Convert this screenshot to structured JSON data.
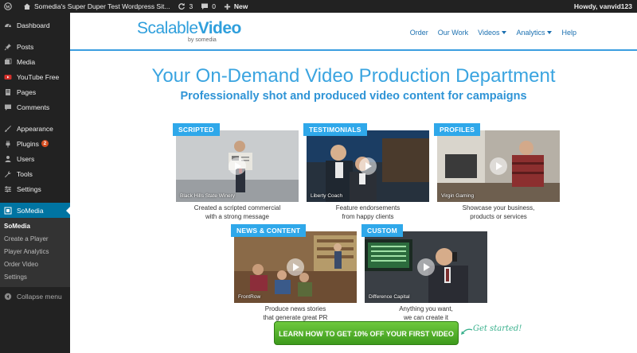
{
  "admin_bar": {
    "site_title": "Somedia's Super Duper Test Wordpress Sit...",
    "updates_count": "3",
    "comments_count": "0",
    "new_label": "New",
    "greeting": "Howdy, vanvid123"
  },
  "sidebar": {
    "items": [
      {
        "label": "Dashboard",
        "icon": "dashboard-icon"
      },
      {
        "label": "Posts",
        "icon": "pin-icon"
      },
      {
        "label": "Media",
        "icon": "media-icon"
      },
      {
        "label": "YouTube Free",
        "icon": "youtube-icon"
      },
      {
        "label": "Pages",
        "icon": "pages-icon"
      },
      {
        "label": "Comments",
        "icon": "comments-icon"
      },
      {
        "label": "Appearance",
        "icon": "brush-icon"
      },
      {
        "label": "Plugins",
        "icon": "plugin-icon",
        "badge": "2"
      },
      {
        "label": "Users",
        "icon": "users-icon"
      },
      {
        "label": "Tools",
        "icon": "wrench-icon"
      },
      {
        "label": "Settings",
        "icon": "settings-icon"
      },
      {
        "label": "SoMedia",
        "icon": "somedia-icon"
      }
    ],
    "submenu": [
      "SoMedia",
      "Create a Player",
      "Player Analytics",
      "Order Video",
      "Settings"
    ],
    "collapse_label": "Collapse menu"
  },
  "nav": {
    "logo_main": "Scalable",
    "logo_bold": "Video",
    "logo_by": "by somedia",
    "links": [
      "Order",
      "Our Work",
      "Videos",
      "Analytics",
      "Help"
    ]
  },
  "hero": {
    "headline": "Your On-Demand Video Production Department",
    "subheadline": "Professionally shot and produced video content for campaigns"
  },
  "cards": [
    {
      "tag": "SCRIPTED",
      "caption": "Black Hills State Winery",
      "desc1": "Created a scripted commercial",
      "desc2": "with a strong message"
    },
    {
      "tag": "TESTIMONIALS",
      "caption": "Liberty Coach",
      "desc1": "Feature endorsements",
      "desc2": "from happy clients"
    },
    {
      "tag": "PROFILES",
      "caption": "Virgin Gaming",
      "desc1": "Showcase your business,",
      "desc2": "products or services"
    },
    {
      "tag": "NEWS & CONTENT",
      "caption": "FrontRow",
      "desc1": "Produce news stories",
      "desc2": "that generate great PR"
    },
    {
      "tag": "CUSTOM",
      "caption": "Difference Capital",
      "desc1": "Anything you want,",
      "desc2": "we can create it"
    }
  ],
  "cta": {
    "button_label": "LEARN HOW TO GET 10% OFF YOUR FIRST VIDEO",
    "note": "Get started!"
  },
  "colors": {
    "accent": "#2fa8ea",
    "admin_bg": "#222222",
    "current_menu": "#0074a2",
    "cta_green": "#4fae28"
  }
}
